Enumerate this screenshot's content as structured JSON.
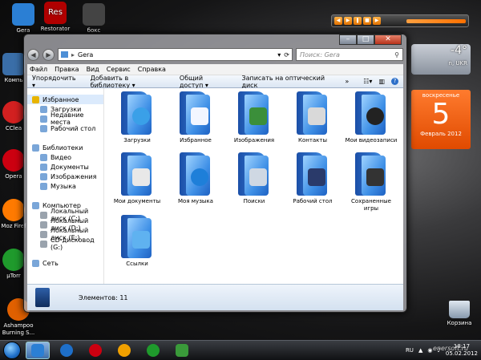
{
  "desktop": {
    "icons": [
      {
        "label": "Gera",
        "color": "#2b7fd4"
      },
      {
        "label": "Res",
        "color": "#b00000"
      },
      {
        "label": "Restorator",
        "color": "#b00000"
      },
      {
        "label": "бокс",
        "color": "#444444"
      },
      {
        "label": "Компь",
        "color": "#3a6ea8"
      },
      {
        "label": "CClea",
        "color": "#d22020"
      },
      {
        "label": "Opera",
        "color": "#cc0010"
      },
      {
        "label": "Moz Firef",
        "color": "#ff7a00"
      },
      {
        "label": "µTorr",
        "color": "#1f9a2c"
      },
      {
        "label": "Ashampoo Burning S...",
        "color": "#e06000"
      }
    ],
    "weather": {
      "temp": "-4°",
      "city": "n, UKR"
    },
    "calendar": {
      "dow": "воскресенье",
      "day": "5",
      "month": "Февраль 2012"
    },
    "trash": "Корзина",
    "watermark": "enersoft.ru"
  },
  "window": {
    "address": "Gera",
    "search_placeholder": "Поиск: Gera",
    "menu": [
      "Файл",
      "Правка",
      "Вид",
      "Сервис",
      "Справка"
    ],
    "commands": [
      "Упорядочить ▾",
      "Добавить в библиотеку ▾",
      "Общий доступ ▾",
      "Записать на оптический диск",
      "»"
    ],
    "nav": {
      "favorites": {
        "title": "Избранное",
        "items": [
          "Загрузки",
          "Недавние места",
          "Рабочий стол"
        ]
      },
      "libraries": {
        "title": "Библиотеки",
        "items": [
          "Видео",
          "Документы",
          "Изображения",
          "Музыка"
        ]
      },
      "computer": {
        "title": "Компьютер",
        "items": [
          "Локальный диск (C:)",
          "Локальный диск (D:)",
          "Локальный диск (E:)",
          "CD-дисковод (G:)"
        ]
      },
      "network": "Сеть"
    },
    "folders": [
      {
        "label": "Загрузки",
        "emb": "#3aa0e8"
      },
      {
        "label": "Избранное",
        "emb": "#f2f6ff"
      },
      {
        "label": "Изображения",
        "emb": "#3b8f3a"
      },
      {
        "label": "Контакты",
        "emb": "#d9d9d9"
      },
      {
        "label": "Мои видеозаписи",
        "emb": "#222222"
      },
      {
        "label": "Мои документы",
        "emb": "#e8e8e8"
      },
      {
        "label": "Моя музыка",
        "emb": "#1e7fd9"
      },
      {
        "label": "Поиски",
        "emb": "#cfd8e3"
      },
      {
        "label": "Рабочий стол",
        "emb": "#2a3a6a"
      },
      {
        "label": "Сохраненные игры",
        "emb": "#333333"
      },
      {
        "label": "Ссылки",
        "emb": "#5fb2f0"
      }
    ],
    "status": "Элементов: 11"
  },
  "taskbar": {
    "lang": "RU",
    "time": "18:17",
    "date": "05.02.2012"
  }
}
